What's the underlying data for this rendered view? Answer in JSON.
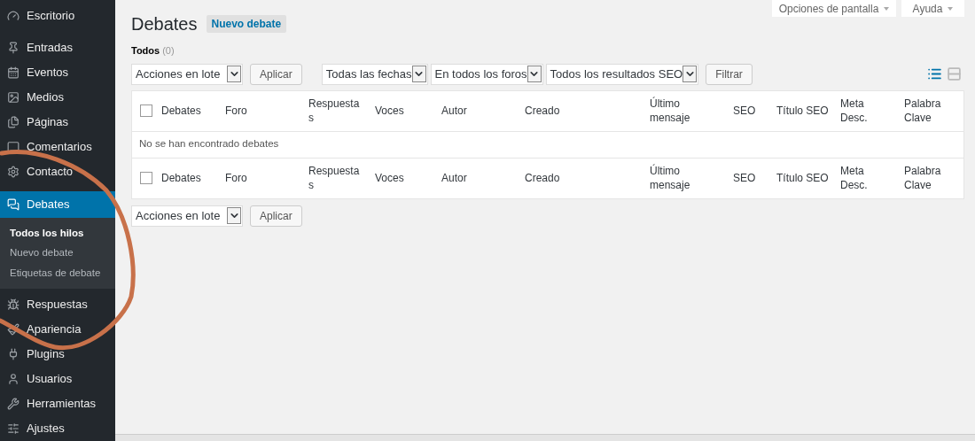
{
  "sidebar": {
    "items": [
      {
        "label": "Escritorio",
        "selected": false
      },
      {
        "label": "Entradas",
        "selected": false
      },
      {
        "label": "Eventos",
        "selected": false
      },
      {
        "label": "Medios",
        "selected": false
      },
      {
        "label": "Páginas",
        "selected": false
      },
      {
        "label": "Comentarios",
        "selected": false
      },
      {
        "label": "Contacto",
        "selected": false
      },
      {
        "label": "Debates",
        "selected": true,
        "children": [
          {
            "label": "Todos los hilos",
            "selected": true
          },
          {
            "label": "Nuevo debate",
            "selected": false
          },
          {
            "label": "Etiquetas de debate",
            "selected": false
          }
        ]
      },
      {
        "label": "Respuestas",
        "selected": false
      },
      {
        "label": "Apariencia",
        "selected": false
      },
      {
        "label": "Plugins",
        "selected": false
      },
      {
        "label": "Usuarios",
        "selected": false
      },
      {
        "label": "Herramientas",
        "selected": false
      },
      {
        "label": "Ajustes",
        "selected": false
      }
    ]
  },
  "screen_tabs": [
    "Opciones de pantalla",
    "Ayuda"
  ],
  "page": {
    "title": "Debates",
    "add_button": "Nuevo debate"
  },
  "filter_links": [
    {
      "label": "Todos",
      "count": "(0)",
      "selected": true
    }
  ],
  "top_toolbar": {
    "bulk_select": "Acciones en lote",
    "apply": "Aplicar",
    "filters": [
      "Todas las fechas",
      "En todos los foros",
      "Todos los resultados SEO"
    ],
    "filter_button": "Filtrar",
    "view_modes": [
      {
        "kind": "list",
        "selected": true
      },
      {
        "kind": "excerpt",
        "selected": false
      }
    ]
  },
  "table": {
    "header_checkbox": {
      "checked": false
    },
    "footer_checkbox": {
      "checked": false
    },
    "columns": [
      "Debates",
      "Foro",
      "Respuesta s",
      "Voces",
      "Autor",
      "Creado",
      "Último mensaje",
      "SEO",
      "Título SEO",
      "Meta Desc.",
      "Palabra Clave"
    ],
    "empty_message": "No se han encontrado debates",
    "footer_columns": [
      "Debates",
      "Foro",
      "Respuesta s",
      "Voces",
      "Autor",
      "Creado",
      "Último mensaje",
      "SEO",
      "Título SEO",
      "Meta Desc.",
      "Palabra Clave"
    ]
  },
  "bottom_toolbar": {
    "bulk_select": "Acciones en lote",
    "apply": "Aplicar"
  }
}
